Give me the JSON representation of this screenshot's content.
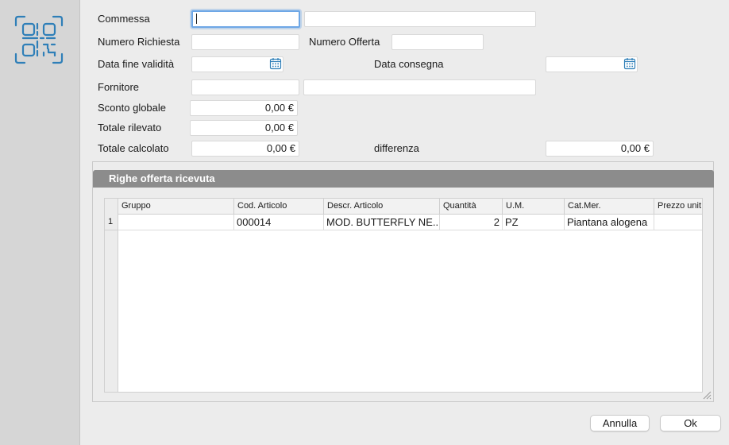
{
  "form": {
    "commessa_label": "Commessa",
    "commessa_value": "",
    "commessa_desc": "",
    "numero_richiesta_label": "Numero Richiesta",
    "numero_richiesta_value": "",
    "numero_offerta_label": "Numero Offerta",
    "numero_offerta_value": "",
    "data_fine_validita_label": "Data fine validità",
    "data_fine_validita_value": "",
    "data_consegna_label": "Data consegna",
    "data_consegna_value": "",
    "fornitore_label": "Fornitore",
    "fornitore_value": "",
    "fornitore_desc": "",
    "sconto_globale_label": "Sconto globale",
    "sconto_globale_value": "0,00 €",
    "totale_rilevato_label": "Totale rilevato",
    "totale_rilevato_value": "0,00 €",
    "totale_calcolato_label": "Totale calcolato",
    "totale_calcolato_value": "0,00 €",
    "differenza_label": "differenza",
    "differenza_value": "0,00 €"
  },
  "panel": {
    "title": "Righe offerta ricevuta",
    "columns": [
      "Gruppo",
      "Cod. Articolo",
      "Descr. Articolo",
      "Quantità",
      "U.M.",
      "Cat.Mer.",
      "Prezzo unit"
    ],
    "rows": [
      {
        "num": "1",
        "gruppo": "",
        "cod_articolo": "000014",
        "descr_articolo": "MOD. BUTTERFLY NE...",
        "quantita": "2",
        "um": "PZ",
        "cat_mer": "Piantana alogena",
        "prezzo_unit": ""
      }
    ]
  },
  "buttons": {
    "annulla": "Annulla",
    "ok": "Ok"
  },
  "icons": {
    "qr": "qr-code-scan-icon",
    "calendar": "calendar-icon"
  },
  "colors": {
    "accent": "#2f7fb8",
    "panel_header": "#8c8c8c",
    "focus_ring": "#6ea7e6"
  }
}
